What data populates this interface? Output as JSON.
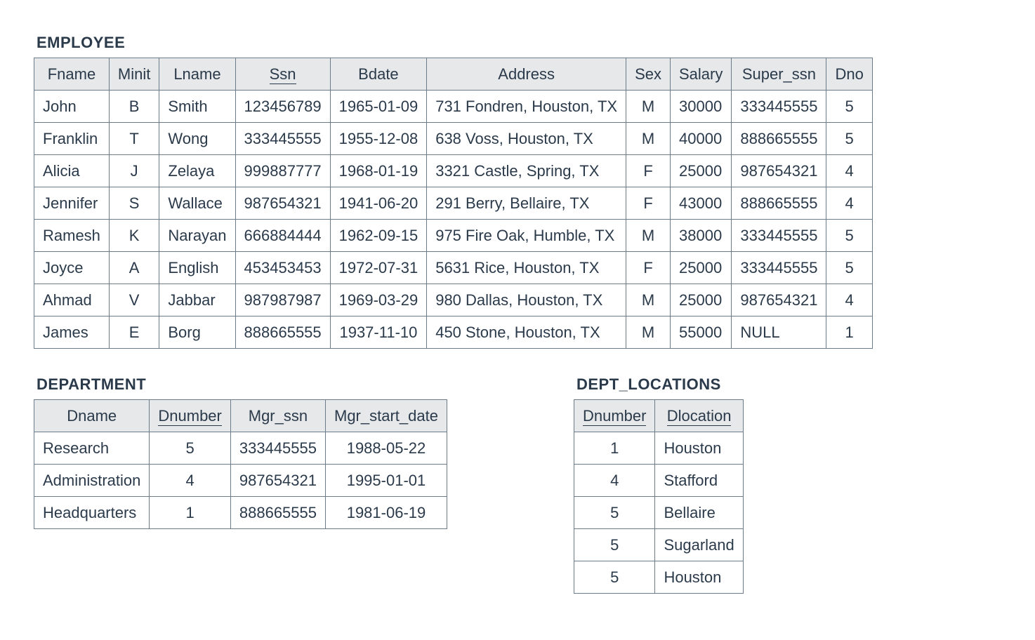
{
  "employee": {
    "title": "EMPLOYEE",
    "columns": [
      {
        "label": "Fname",
        "underline": false
      },
      {
        "label": "Minit",
        "underline": false
      },
      {
        "label": "Lname",
        "underline": false
      },
      {
        "label": "Ssn",
        "underline": true
      },
      {
        "label": "Bdate",
        "underline": false
      },
      {
        "label": "Address",
        "underline": false
      },
      {
        "label": "Sex",
        "underline": false
      },
      {
        "label": "Salary",
        "underline": false
      },
      {
        "label": "Super_ssn",
        "underline": false
      },
      {
        "label": "Dno",
        "underline": false
      }
    ],
    "align": [
      "l",
      "c",
      "l",
      "c",
      "c",
      "l",
      "c",
      "l",
      "l",
      "c"
    ],
    "rows": [
      [
        "John",
        "B",
        "Smith",
        "123456789",
        "1965-01-09",
        "731 Fondren, Houston, TX",
        "M",
        "30000",
        "333445555",
        "5"
      ],
      [
        "Franklin",
        "T",
        "Wong",
        "333445555",
        "1955-12-08",
        "638 Voss, Houston, TX",
        "M",
        "40000",
        "888665555",
        "5"
      ],
      [
        "Alicia",
        "J",
        "Zelaya",
        "999887777",
        "1968-01-19",
        "3321 Castle, Spring, TX",
        "F",
        "25000",
        "987654321",
        "4"
      ],
      [
        "Jennifer",
        "S",
        "Wallace",
        "987654321",
        "1941-06-20",
        "291 Berry, Bellaire, TX",
        "F",
        "43000",
        "888665555",
        "4"
      ],
      [
        "Ramesh",
        "K",
        "Narayan",
        "666884444",
        "1962-09-15",
        "975 Fire Oak, Humble, TX",
        "M",
        "38000",
        "333445555",
        "5"
      ],
      [
        "Joyce",
        "A",
        "English",
        "453453453",
        "1972-07-31",
        "5631 Rice, Houston, TX",
        "F",
        "25000",
        "333445555",
        "5"
      ],
      [
        "Ahmad",
        "V",
        "Jabbar",
        "987987987",
        "1969-03-29",
        "980 Dallas, Houston, TX",
        "M",
        "25000",
        "987654321",
        "4"
      ],
      [
        "James",
        "E",
        "Borg",
        "888665555",
        "1937-11-10",
        "450 Stone, Houston, TX",
        "M",
        "55000",
        "NULL",
        "1"
      ]
    ]
  },
  "department": {
    "title": "DEPARTMENT",
    "columns": [
      {
        "label": "Dname",
        "underline": false
      },
      {
        "label": "Dnumber",
        "underline": true
      },
      {
        "label": "Mgr_ssn",
        "underline": false
      },
      {
        "label": "Mgr_start_date",
        "underline": false
      }
    ],
    "align": [
      "l",
      "c",
      "c",
      "c"
    ],
    "rows": [
      [
        "Research",
        "5",
        "333445555",
        "1988-05-22"
      ],
      [
        "Administration",
        "4",
        "987654321",
        "1995-01-01"
      ],
      [
        "Headquarters",
        "1",
        "888665555",
        "1981-06-19"
      ]
    ]
  },
  "dept_locations": {
    "title": "DEPT_LOCATIONS",
    "columns": [
      {
        "label": "Dnumber",
        "underline": true
      },
      {
        "label": "Dlocation",
        "underline": true
      }
    ],
    "align": [
      "c",
      "l"
    ],
    "rows": [
      [
        "1",
        "Houston"
      ],
      [
        "4",
        "Stafford"
      ],
      [
        "5",
        "Bellaire"
      ],
      [
        "5",
        "Sugarland"
      ],
      [
        "5",
        "Houston"
      ]
    ]
  }
}
